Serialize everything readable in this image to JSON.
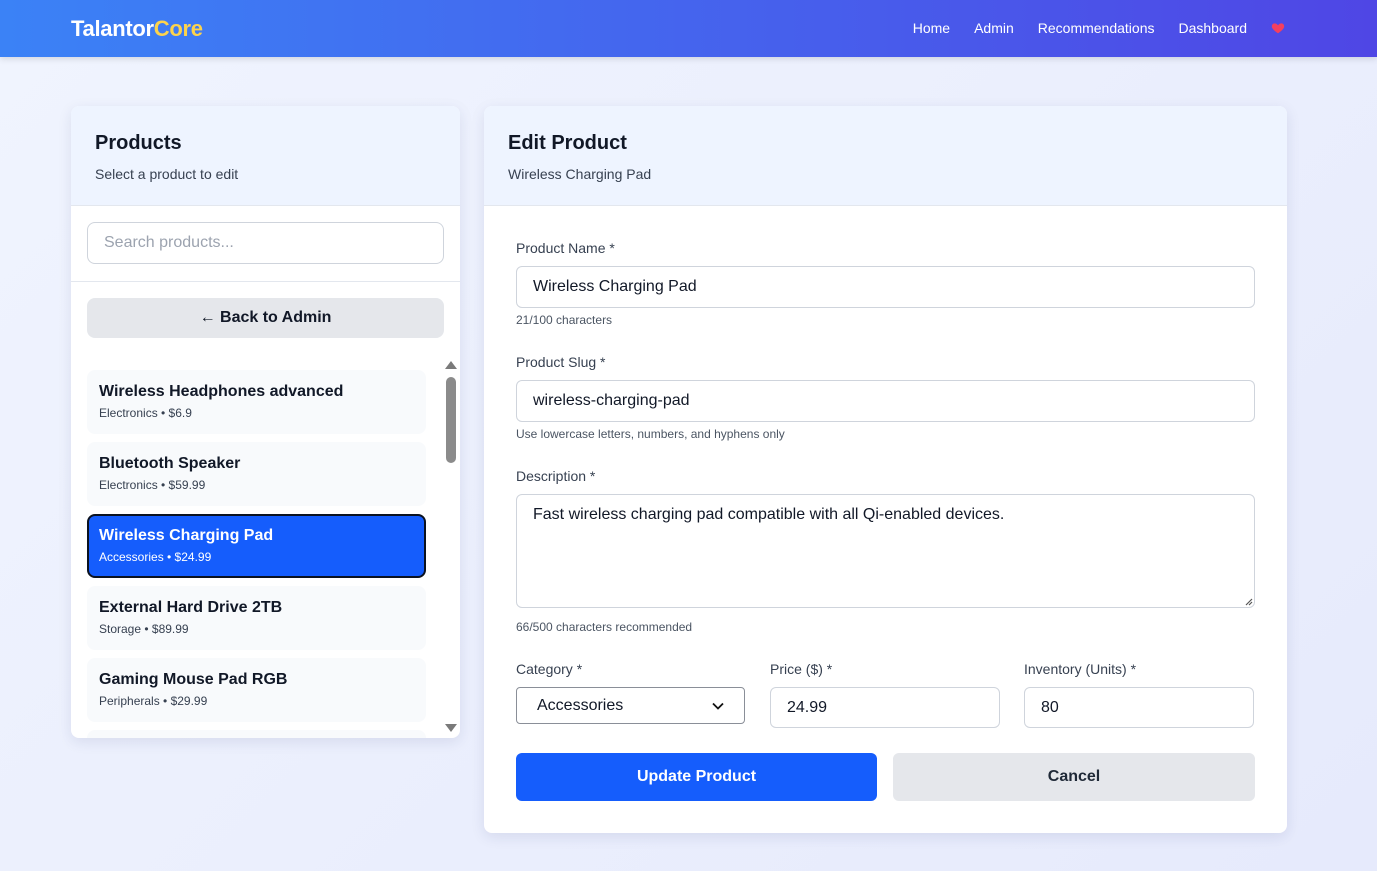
{
  "nav": {
    "brand_main": "Talantor",
    "brand_accent": "Core",
    "links": [
      "Home",
      "Admin",
      "Recommendations",
      "Dashboard"
    ],
    "heart_icon": "heart-icon",
    "heart_color": "#f43f5e"
  },
  "products_panel": {
    "title": "Products",
    "subtitle": "Select a product to edit",
    "search_placeholder": "Search products...",
    "back_label": "← Back to Admin",
    "items": [
      {
        "name": "Wireless Headphones advanced",
        "meta": "Electronics • $6.9",
        "selected": false
      },
      {
        "name": "Bluetooth Speaker",
        "meta": "Electronics • $59.99",
        "selected": false
      },
      {
        "name": "Wireless Charging Pad",
        "meta": "Accessories • $24.99",
        "selected": true
      },
      {
        "name": "External Hard Drive 2TB",
        "meta": "Storage • $89.99",
        "selected": false
      },
      {
        "name": "Gaming Mouse Pad RGB",
        "meta": "Peripherals • $29.99",
        "selected": false
      }
    ]
  },
  "edit_panel": {
    "title": "Edit Product",
    "subtitle": "Wireless Charging Pad",
    "name_label": "Product Name *",
    "name_value": "Wireless Charging Pad",
    "name_hint": "21/100 characters",
    "slug_label": "Product Slug *",
    "slug_value": "wireless-charging-pad",
    "slug_hint": "Use lowercase letters, numbers, and hyphens only",
    "description_label": "Description *",
    "description_value": "Fast wireless charging pad compatible with all Qi-enabled devices.",
    "description_hint": "66/500 characters recommended",
    "category_label": "Category *",
    "category_value": "Accessories",
    "price_label": "Price ($) *",
    "price_value": "24.99",
    "inventory_label": "Inventory (Units) *",
    "inventory_value": "80",
    "update_label": "Update Product",
    "cancel_label": "Cancel"
  },
  "colors": {
    "primary": "#155dfc",
    "header_gradient_start": "#3b82f6",
    "header_gradient_end": "#4f46e5",
    "brand_accent": "#fcd34d"
  }
}
